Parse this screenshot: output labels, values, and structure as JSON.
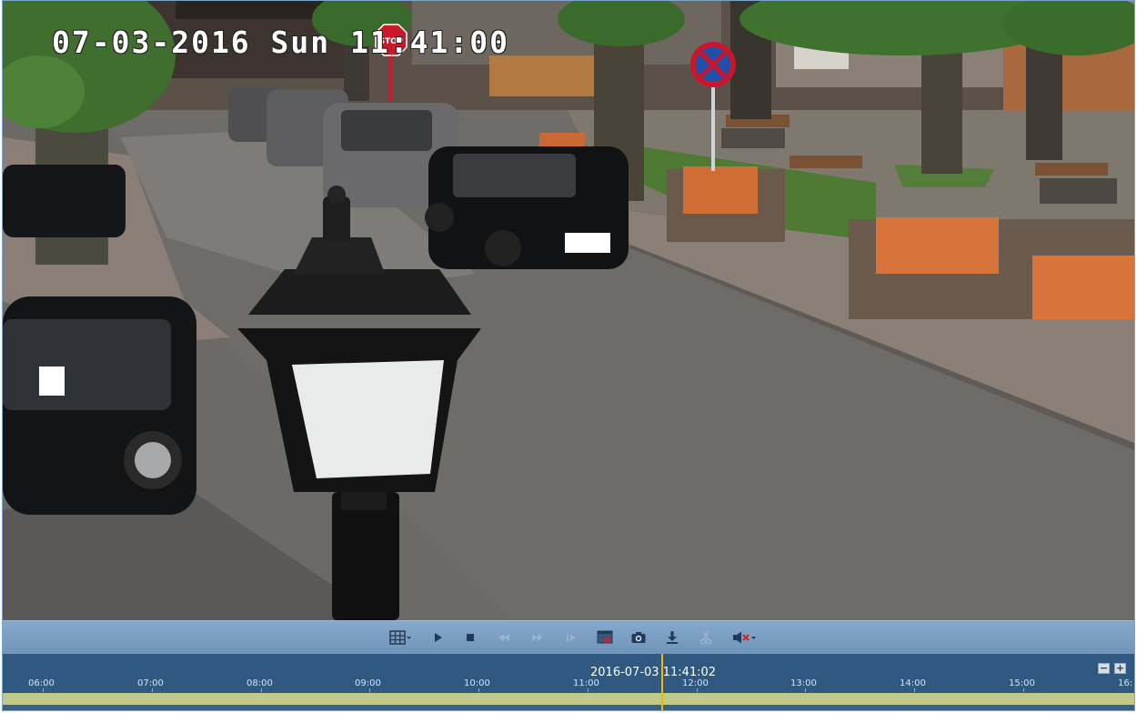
{
  "video": {
    "osd_timestamp": "07-03-2016 Sun 11:41:00",
    "stop_sign_text": "STOP"
  },
  "toolbar": {
    "buttons": [
      {
        "name": "layout-grid-button",
        "icon": "grid-icon"
      },
      {
        "name": "play-button",
        "icon": "play-icon"
      },
      {
        "name": "stop-button",
        "icon": "stop-icon"
      },
      {
        "name": "slow-backward-button",
        "icon": "rewind-icon"
      },
      {
        "name": "fast-forward-button",
        "icon": "fast-forward-icon"
      },
      {
        "name": "frame-step-button",
        "icon": "frame-step-icon"
      },
      {
        "name": "close-all-windows-button",
        "icon": "window-close-icon"
      },
      {
        "name": "snapshot-button",
        "icon": "camera-icon"
      },
      {
        "name": "download-button",
        "icon": "download-icon"
      },
      {
        "name": "clip-button",
        "icon": "scissors-icon"
      },
      {
        "name": "mute-button",
        "icon": "speaker-muted-icon"
      }
    ]
  },
  "timeline": {
    "current_time": "2016-07-03 11:41:02",
    "ticks": [
      "06:00",
      "07:00",
      "08:00",
      "09:00",
      "10:00",
      "11:00",
      "12:00",
      "13:00",
      "14:00",
      "15:00",
      "16:"
    ],
    "zoom_out_label": "−",
    "zoom_in_label": "+",
    "colors": {
      "background": "#2f5980",
      "recording_band": "#bfc98a",
      "cursor": "#f2b800"
    }
  }
}
